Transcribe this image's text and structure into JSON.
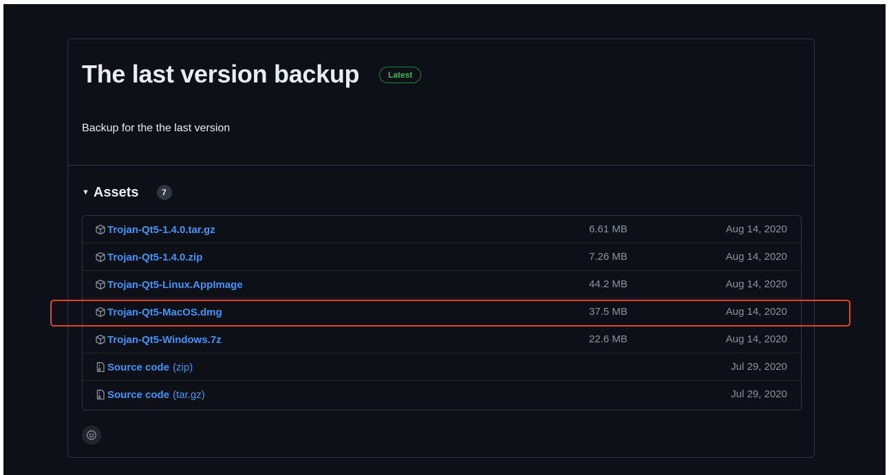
{
  "release": {
    "title": "The last version backup",
    "badge": "Latest",
    "description": "Backup for the the last version"
  },
  "assets": {
    "label": "Assets",
    "count": "7",
    "items": [
      {
        "name": "Trojan-Qt5-1.4.0.tar.gz",
        "suffix": "",
        "size": "6.61 MB",
        "date": "Aug 14, 2020",
        "icon": "package-icon"
      },
      {
        "name": "Trojan-Qt5-1.4.0.zip",
        "suffix": "",
        "size": "7.26 MB",
        "date": "Aug 14, 2020",
        "icon": "package-icon"
      },
      {
        "name": "Trojan-Qt5-Linux.AppImage",
        "suffix": "",
        "size": "44.2 MB",
        "date": "Aug 14, 2020",
        "icon": "package-icon"
      },
      {
        "name": "Trojan-Qt5-MacOS.dmg",
        "suffix": "",
        "size": "37.5 MB",
        "date": "Aug 14, 2020",
        "icon": "package-icon"
      },
      {
        "name": "Trojan-Qt5-Windows.7z",
        "suffix": "",
        "size": "22.6 MB",
        "date": "Aug 14, 2020",
        "icon": "package-icon"
      },
      {
        "name": "Source code",
        "suffix": "(zip)",
        "size": "",
        "date": "Jul 29, 2020",
        "icon": "file-zip-icon"
      },
      {
        "name": "Source code",
        "suffix": "(tar.gz)",
        "size": "",
        "date": "Jul 29, 2020",
        "icon": "file-zip-icon"
      }
    ]
  },
  "colors": {
    "background": "#0d1117",
    "border": "#30363d",
    "link": "#4493f8",
    "badge_green": "#3fb950",
    "highlight": "#e8412c"
  }
}
